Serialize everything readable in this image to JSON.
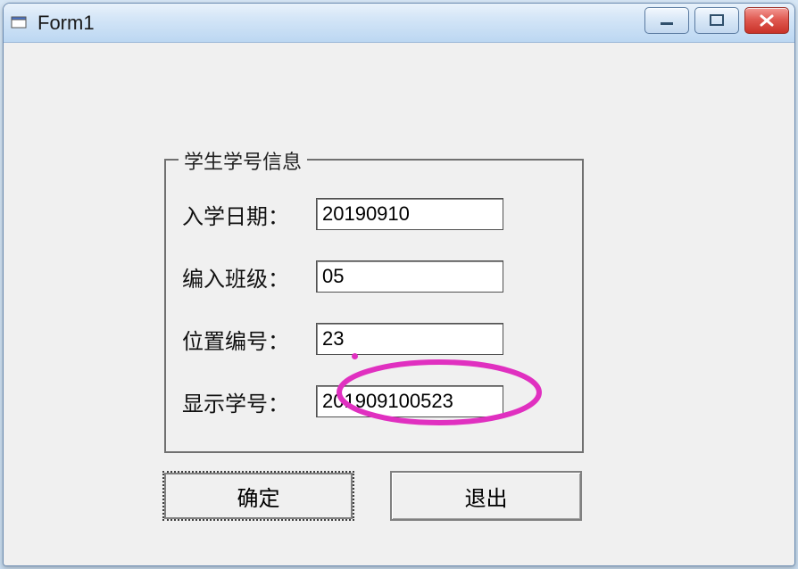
{
  "window": {
    "title": "Form1"
  },
  "groupbox": {
    "legend": "学生学号信息",
    "rows": {
      "date": {
        "label": "入学日期：",
        "value": "20190910"
      },
      "class": {
        "label": "编入班级：",
        "value": "05"
      },
      "pos": {
        "label": "位置编号：",
        "value": "23"
      },
      "result": {
        "label": "显示学号：",
        "value": "201909100523"
      }
    }
  },
  "buttons": {
    "ok": "确定",
    "exit": "退出"
  },
  "highlight": {
    "color": "#e030c0"
  }
}
